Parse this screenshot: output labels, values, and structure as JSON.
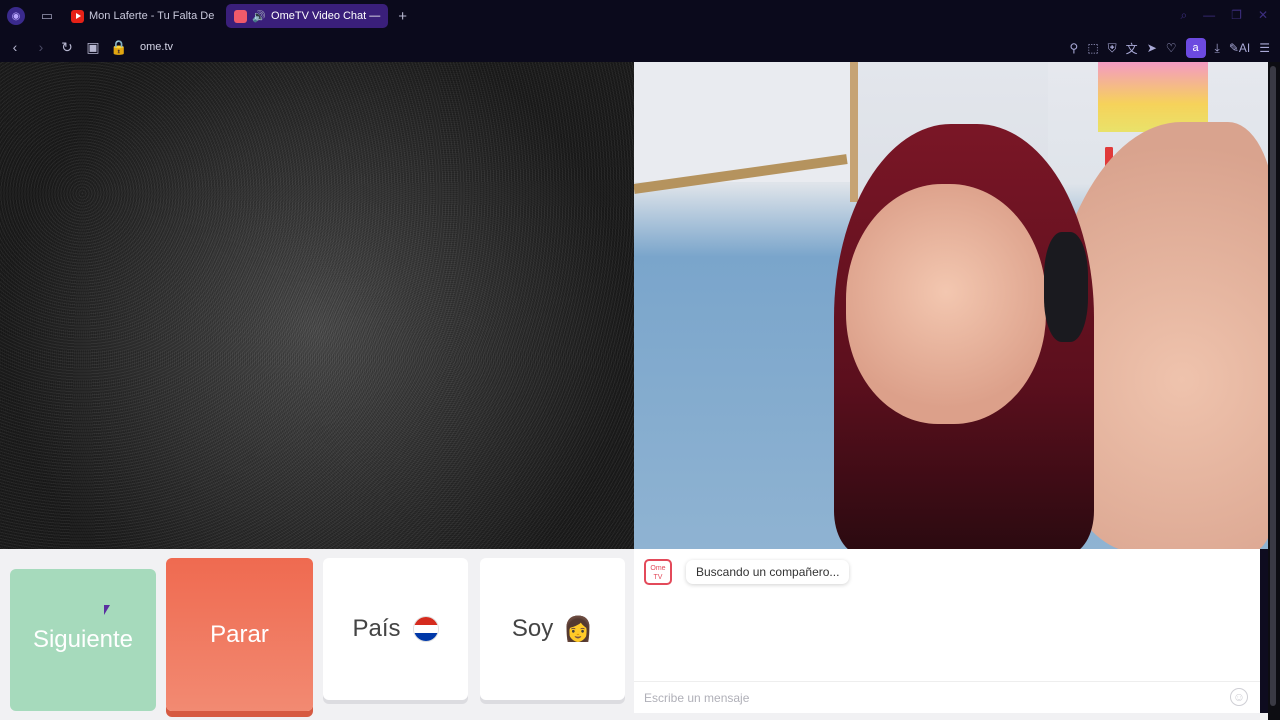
{
  "browser": {
    "tabs": [
      {
        "label": "Mon Laferte - Tu Falta De",
        "favicon": "youtube-icon",
        "active": false
      },
      {
        "label": "OmeTV Video Chat —",
        "favicon": "ometv-icon",
        "active": true,
        "audio": true
      }
    ],
    "url": "ome.tv",
    "profile_initial": "a",
    "ai_label": "AI"
  },
  "controls": {
    "next_label": "Siguiente",
    "stop_label": "Parar",
    "country_label": "País",
    "gender_label": "Soy",
    "gender_emoji": "👩",
    "colors": {
      "next": "#a6dabc",
      "stop": "#ef6a50"
    }
  },
  "chat": {
    "logo_text_line1": "Ome",
    "logo_text_line2": "TV",
    "status_message": "Buscando un compañero...",
    "input_placeholder": "Escribe un mensaje",
    "emoji_button": "☺"
  }
}
